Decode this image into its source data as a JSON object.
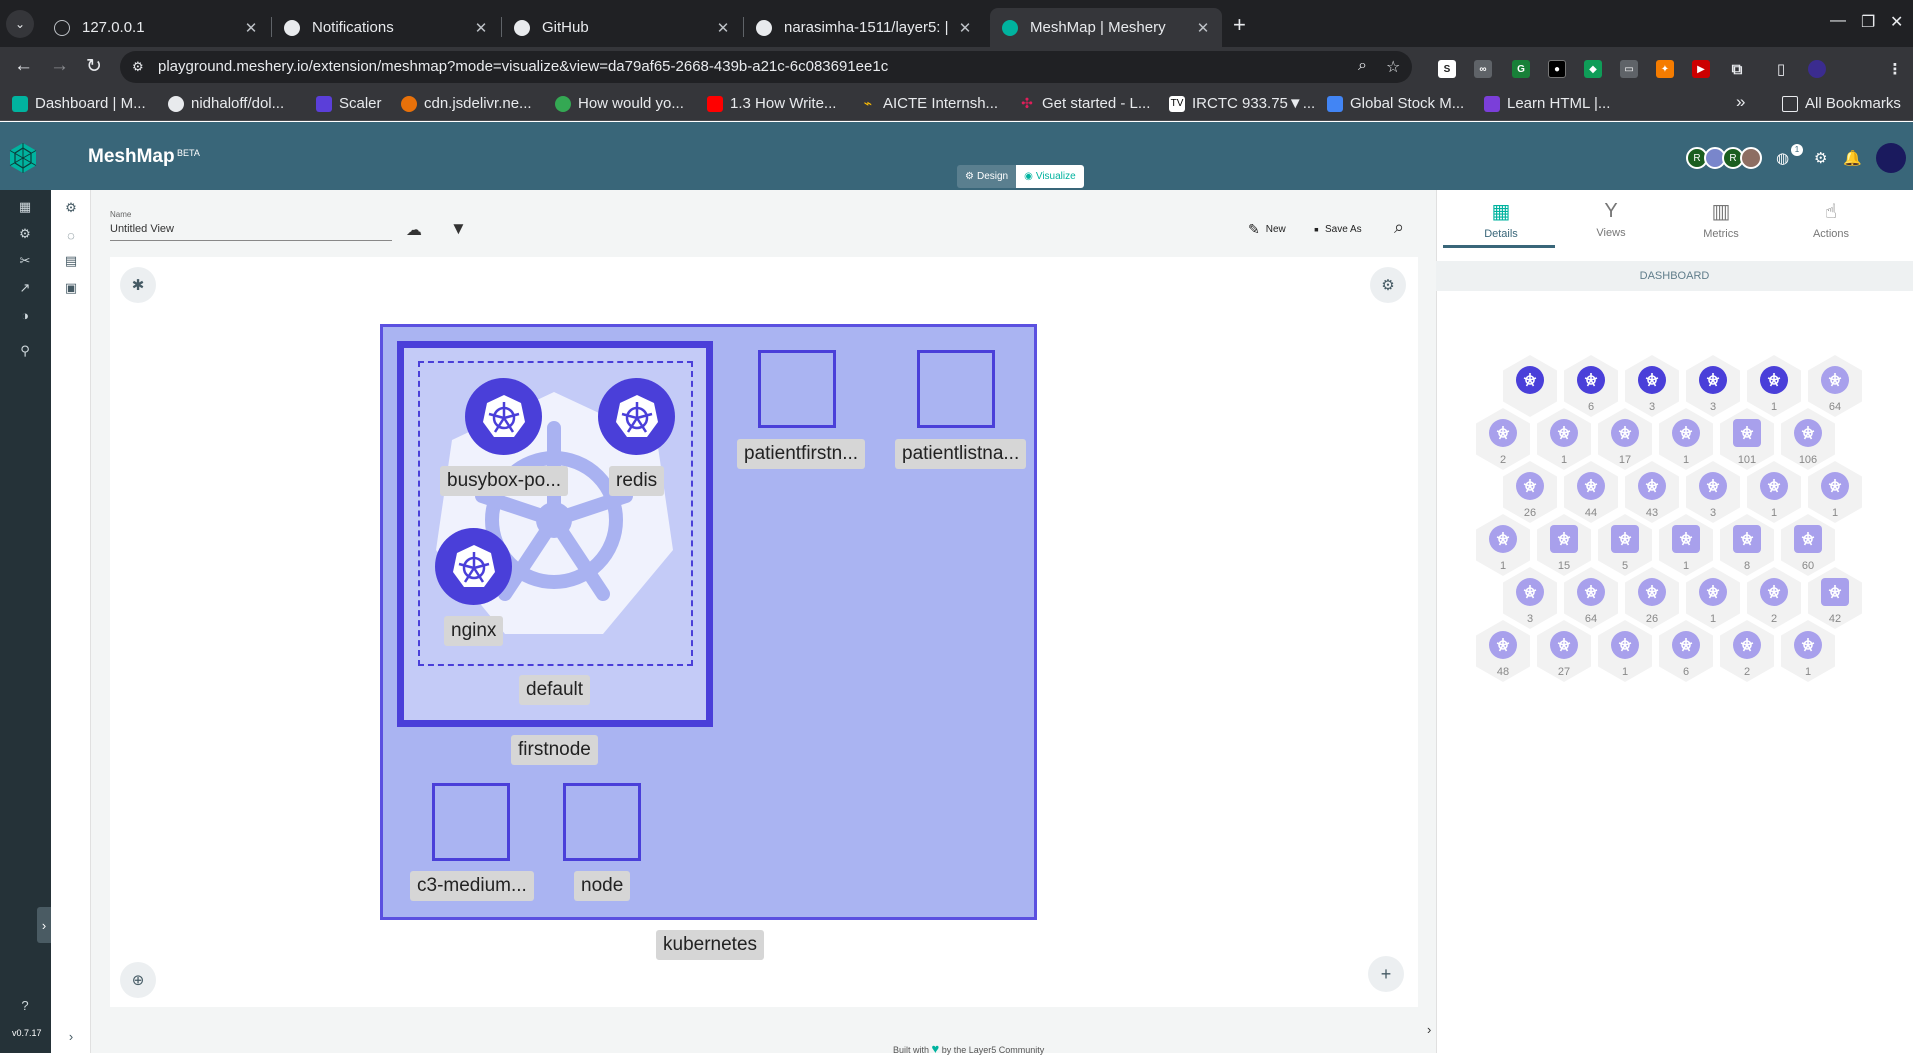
{
  "browser": {
    "tabs": [
      {
        "title": "127.0.0.1",
        "close": "✕"
      },
      {
        "title": "Notifications",
        "close": "✕"
      },
      {
        "title": "GitHub",
        "close": "✕"
      },
      {
        "title": "narasimha-1511/layer5: |",
        "close": "✕"
      },
      {
        "title": "MeshMap | Meshery",
        "close": "✕"
      }
    ],
    "new_tab": "+",
    "url": "playground.meshery.io/extension/meshmap?mode=visualize&view=da79af65-2668-439b-a21c-6c083691ee1c",
    "bookmarks": [
      "Dashboard | M...",
      "nidhaloff/dol...",
      "Scaler",
      "cdn.jsdelivr.ne...",
      "How would yo...",
      "1.3 How Write...",
      "AICTE Internsh...",
      "Get started - L...",
      "IRCTC 933.75▼...",
      "Global Stock M...",
      "Learn HTML |..."
    ],
    "bookmarks_more": "»",
    "all_bookmarks": "All Bookmarks"
  },
  "app": {
    "title": "MeshMap",
    "beta": "BETA",
    "mode": {
      "design": "Design",
      "visualize": "Visualize"
    },
    "avatars": [
      "R",
      "",
      "R",
      ""
    ],
    "notification_badge": "1",
    "version": "v0.7.17"
  },
  "toolbar": {
    "name_label": "Name",
    "name_value": "Untitled View",
    "new_label": "New",
    "save_as_label": "Save As"
  },
  "graph": {
    "cluster_label": "kubernetes",
    "node_label": "firstnode",
    "namespace_label": "default",
    "pods": [
      "busybox-po...",
      "redis",
      "nginx"
    ],
    "boxes": [
      "patientfirstn...",
      "patientlistna...",
      "c3-medium...",
      "node"
    ]
  },
  "right_panel": {
    "tabs": [
      "Details",
      "Views",
      "Metrics",
      "Actions"
    ],
    "section": "DASHBOARD",
    "hex_rows": [
      [
        {
          "c": ""
        },
        {
          "c": "6"
        },
        {
          "c": "3"
        },
        {
          "c": "3"
        },
        {
          "c": "1"
        },
        {
          "c": "64"
        }
      ],
      [
        {
          "c": "2"
        },
        {
          "c": "1"
        },
        {
          "c": "17"
        },
        {
          "c": "1"
        },
        {
          "c": "101"
        },
        {
          "c": "106"
        }
      ],
      [
        {
          "c": "26"
        },
        {
          "c": "44"
        },
        {
          "c": "43"
        },
        {
          "c": "3"
        },
        {
          "c": "1"
        },
        {
          "c": "1"
        }
      ],
      [
        {
          "c": "1"
        },
        {
          "c": "15"
        },
        {
          "c": "5"
        },
        {
          "c": "1"
        },
        {
          "c": "8"
        },
        {
          "c": "60"
        }
      ],
      [
        {
          "c": "3"
        },
        {
          "c": "64"
        },
        {
          "c": "26"
        },
        {
          "c": "1"
        },
        {
          "c": "2"
        },
        {
          "c": "42"
        }
      ],
      [
        {
          "c": "48"
        },
        {
          "c": "27"
        },
        {
          "c": "1"
        },
        {
          "c": "6"
        },
        {
          "c": "2"
        },
        {
          "c": "1"
        }
      ]
    ]
  },
  "footer": {
    "built_with": "Built with",
    "by": "by the Layer5 Community"
  },
  "colors": {
    "header": "#396679",
    "accent": "#00b39f",
    "k8s_purple": "#4a3fd9",
    "cluster_fill": "#aab4f2"
  }
}
